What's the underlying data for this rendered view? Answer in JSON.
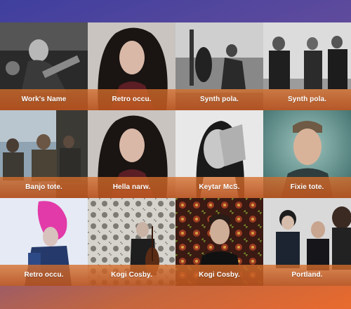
{
  "tiles": [
    {
      "title": "Work's Name",
      "image": "guitarist-performing-photo"
    },
    {
      "title": "Retro occu.",
      "image": "dark-haired-woman-portrait-photo"
    },
    {
      "title": "Synth pola.",
      "image": "band-on-stage-photo"
    },
    {
      "title": "Synth pola.",
      "image": "three-men-standing-photo"
    },
    {
      "title": "Banjo tote.",
      "image": "band-group-outdoors-photo"
    },
    {
      "title": "Hella narw.",
      "image": "dark-haired-woman-portrait-photo"
    },
    {
      "title": "Keytar McS.",
      "image": "woman-hand-over-face-photo"
    },
    {
      "title": "Fixie tote.",
      "image": "man-portrait-teal-photo"
    },
    {
      "title": "Retro occu.",
      "image": "pink-haired-singer-photo"
    },
    {
      "title": "Kogi Cosby.",
      "image": "cellist-patterned-wall-photo"
    },
    {
      "title": "Kogi Cosby.",
      "image": "man-floral-backdrop-photo"
    },
    {
      "title": "Portland.",
      "image": "trio-portrait-photo"
    }
  ],
  "colors": {
    "background_top": "#3f3f9e",
    "background_bottom": "#e96a2d",
    "caption_bar": "#c4622a"
  }
}
